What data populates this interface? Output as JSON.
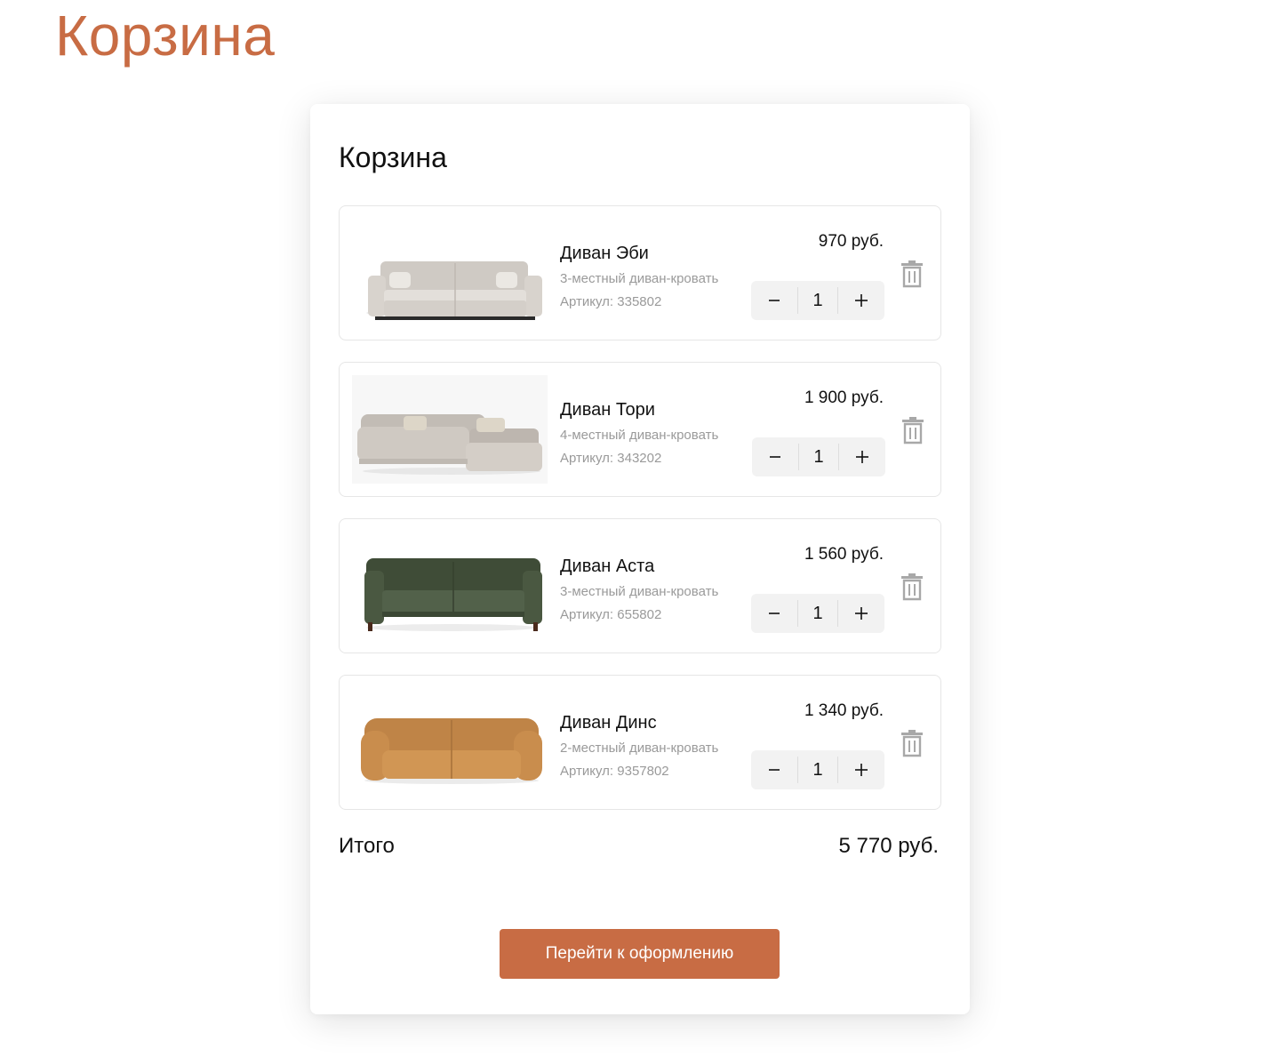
{
  "page": {
    "heading": "Корзина"
  },
  "cart": {
    "title": "Корзина",
    "items": [
      {
        "name": "Диван Эби",
        "description": "3-местный диван-кровать",
        "sku": "Артикул: 335802",
        "price": "970 руб.",
        "quantity": "1",
        "image_icon": "sofa-image",
        "sofa_color": "#d6d2cd"
      },
      {
        "name": "Диван Тори",
        "description": "4-местный диван-кровать",
        "sku": "Артикул: 343202",
        "price": "1 900 руб.",
        "quantity": "1",
        "image_icon": "corner-sofa-image",
        "sofa_color": "#cbc5bf"
      },
      {
        "name": "Диван Аста",
        "description": "3-местный диван-кровать",
        "sku": "Артикул: 655802",
        "price": "1 560 руб.",
        "quantity": "1",
        "image_icon": "sofa-image",
        "sofa_color": "#45533c"
      },
      {
        "name": "Диван Динс",
        "description": "2-местный диван-кровать",
        "sku": "Артикул: 9357802",
        "price": "1 340 руб.",
        "quantity": "1",
        "image_icon": "sofa-image",
        "sofa_color": "#c98d4d"
      }
    ],
    "total_label": "Итого",
    "total_value": "5 770 руб.",
    "checkout_label": "Перейти к оформлению"
  },
  "colors": {
    "accent": "#c86c44",
    "muted_text": "#9a9a9a",
    "stepper_bg": "#f2f2f2",
    "trash_icon": "#a8a8a8"
  }
}
